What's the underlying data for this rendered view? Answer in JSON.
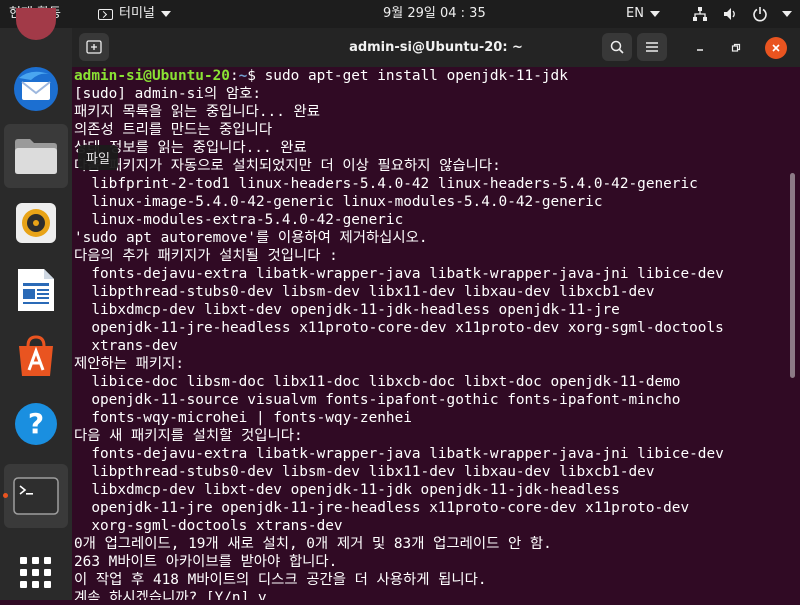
{
  "topbar": {
    "activities": "현재 활동",
    "app_name": "터미널",
    "clock": "9월 29일  04 : 35",
    "lang": "EN"
  },
  "dock": {
    "tooltip": "파일",
    "items": [
      {
        "name": "thunderbird"
      },
      {
        "name": "files"
      },
      {
        "name": "rhythmbox"
      },
      {
        "name": "libreoffice-writer"
      },
      {
        "name": "ubuntu-software"
      },
      {
        "name": "help"
      },
      {
        "name": "terminal"
      },
      {
        "name": "show-applications"
      }
    ]
  },
  "window": {
    "title": "admin-si@Ubuntu-20: ~"
  },
  "terminal": {
    "prompt_user": "admin-si@Ubuntu-20",
    "prompt_sep": ":",
    "prompt_path": "~",
    "prompt_end": "$ ",
    "command": "sudo apt-get install openjdk-11-jdk",
    "lines": [
      "[sudo] admin-si의 암호:",
      "패키지 목록을 읽는 중입니다... 완료",
      "의존성 트리를 만드는 중입니다",
      "상태 정보를 읽는 중입니다... 완료",
      "다음 패키지가 자동으로 설치되었지만 더 이상 필요하지 않습니다:",
      "  libfprint-2-tod1 linux-headers-5.4.0-42 linux-headers-5.4.0-42-generic",
      "  linux-image-5.4.0-42-generic linux-modules-5.4.0-42-generic",
      "  linux-modules-extra-5.4.0-42-generic",
      "'sudo apt autoremove'를 이용하여 제거하십시오.",
      "다음의 추가 패키지가 설치될 것입니다 :",
      "  fonts-dejavu-extra libatk-wrapper-java libatk-wrapper-java-jni libice-dev",
      "  libpthread-stubs0-dev libsm-dev libx11-dev libxau-dev libxcb1-dev",
      "  libxdmcp-dev libxt-dev openjdk-11-jdk-headless openjdk-11-jre",
      "  openjdk-11-jre-headless x11proto-core-dev x11proto-dev xorg-sgml-doctools",
      "  xtrans-dev",
      "제안하는 패키지:",
      "  libice-doc libsm-doc libx11-doc libxcb-doc libxt-doc openjdk-11-demo",
      "  openjdk-11-source visualvm fonts-ipafont-gothic fonts-ipafont-mincho",
      "  fonts-wqy-microhei | fonts-wqy-zenhei",
      "다음 새 패키지를 설치할 것입니다:",
      "  fonts-dejavu-extra libatk-wrapper-java libatk-wrapper-java-jni libice-dev",
      "  libpthread-stubs0-dev libsm-dev libx11-dev libxau-dev libxcb1-dev",
      "  libxdmcp-dev libxt-dev openjdk-11-jdk openjdk-11-jdk-headless",
      "  openjdk-11-jre openjdk-11-jre-headless x11proto-core-dev x11proto-dev",
      "  xorg-sgml-doctools xtrans-dev",
      "0개 업그레이드, 19개 새로 설치, 0개 제거 및 83개 업그레이드 안 함.",
      "263 M바이트 아카이브를 받아야 합니다.",
      "이 작업 후 418 M바이트의 디스크 공간을 더 사용하게 됩니다.",
      "계속 하시겠습니까? [Y/n] y"
    ]
  },
  "colors": {
    "terminal_bg": "#300a24",
    "prompt_user": "#8ae234",
    "prompt_path": "#729fcf",
    "accent": "#e95420",
    "close_button": "#e95420"
  }
}
